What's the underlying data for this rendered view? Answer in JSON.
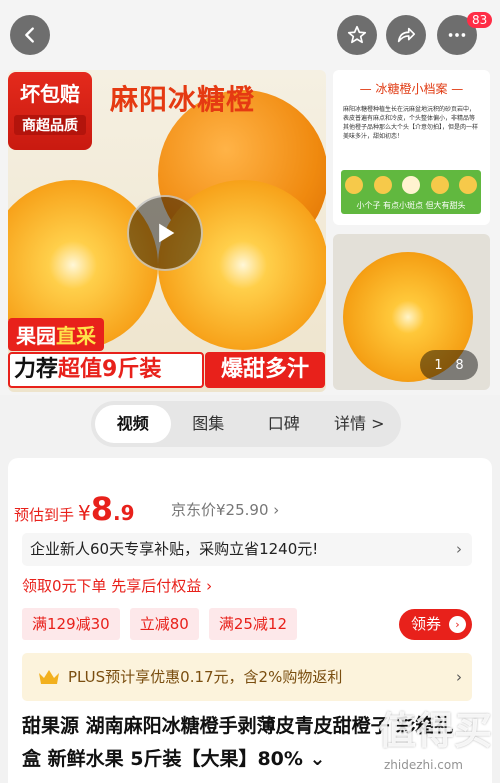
{
  "header": {
    "badge_count": "83",
    "icons": [
      "back-icon",
      "star-icon",
      "share-icon",
      "more-icon"
    ]
  },
  "gallery": {
    "tag_line1": "坏包赔",
    "tag_line2": "商超品质",
    "title": "麻阳冰糖橙",
    "banner_direct": "果园",
    "banner_direct_hl": "直采",
    "banner_rec_a": "力荐",
    "banner_rec_b": "超值9斤装",
    "banner_sweet": "爆甜多汁",
    "side_caption": "— 冰糖橙小档案 —",
    "side_text": "麻阳冰糖橙种植生长在沅麻盆地沅积的砂页岩中，表皮普遍有麻点和冷皮，个头整体偏小，非精品等其他橙子品种那么大个头【介意勿拍】，但是肉一样美味多汁，甜如初恋！",
    "side_strip": "小个子 有点小斑点 但大有甜头",
    "pager_current": "1",
    "pager_total": "8"
  },
  "tabs": [
    {
      "label": "视频",
      "active": true
    },
    {
      "label": "图集",
      "active": false
    },
    {
      "label": "口碑",
      "active": false
    },
    {
      "label": "详情 >",
      "active": false
    }
  ],
  "price": {
    "label": "预估到手",
    "yen": "¥",
    "int": "8",
    "dec": ".9",
    "jd_price": "京东价¥25.90 ›"
  },
  "subsidy": {
    "text": "企业新人60天专享补贴，采购立省1240元!",
    "arrow": "›"
  },
  "lead": "领取0元下单 先享后付权益 ›",
  "coupons": [
    "满129减30",
    "立减80",
    "满25减12"
  ],
  "get_coupon": {
    "label": "领券",
    "arrow": "›"
  },
  "plus": {
    "text": "PLUS预计享优惠0.17元，含2%购物返利",
    "arrow": "›"
  },
  "product_title": "甜果源 湖南麻阳冰糖橙手剥薄皮青皮甜橙子 彩箱礼盒 新鲜水果 5斤装【大果】80% ⌄",
  "watermark": {
    "big": "值得买",
    "small": "zhidezhi.com"
  },
  "colors": {
    "accent": "#e8211b",
    "plus_bg": "#fcf3dc"
  }
}
